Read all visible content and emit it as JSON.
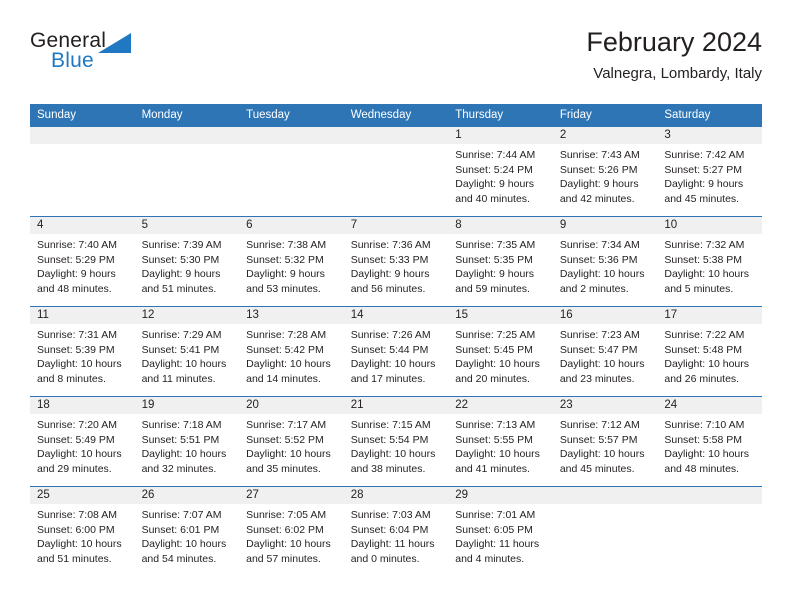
{
  "brand": {
    "name_top": "General",
    "name_bottom": "Blue",
    "accent_color": "#1f78c1"
  },
  "header": {
    "month_title": "February 2024",
    "location": "Valnegra, Lombardy, Italy"
  },
  "colors": {
    "header_blue": "#2e75b6",
    "daynum_band": "#f0f0f0",
    "text": "#231f20"
  },
  "weekday_headers": [
    "Sunday",
    "Monday",
    "Tuesday",
    "Wednesday",
    "Thursday",
    "Friday",
    "Saturday"
  ],
  "labels": {
    "sunrise_prefix": "Sunrise:",
    "sunset_prefix": "Sunset:",
    "daylight_prefix": "Daylight:"
  },
  "weeks": [
    [
      {
        "day": "",
        "sunrise": "",
        "sunset": "",
        "daylight_line1": "",
        "daylight_line2": ""
      },
      {
        "day": "",
        "sunrise": "",
        "sunset": "",
        "daylight_line1": "",
        "daylight_line2": ""
      },
      {
        "day": "",
        "sunrise": "",
        "sunset": "",
        "daylight_line1": "",
        "daylight_line2": ""
      },
      {
        "day": "",
        "sunrise": "",
        "sunset": "",
        "daylight_line1": "",
        "daylight_line2": ""
      },
      {
        "day": "1",
        "sunrise": "Sunrise: 7:44 AM",
        "sunset": "Sunset: 5:24 PM",
        "daylight_line1": "Daylight: 9 hours",
        "daylight_line2": "and 40 minutes."
      },
      {
        "day": "2",
        "sunrise": "Sunrise: 7:43 AM",
        "sunset": "Sunset: 5:26 PM",
        "daylight_line1": "Daylight: 9 hours",
        "daylight_line2": "and 42 minutes."
      },
      {
        "day": "3",
        "sunrise": "Sunrise: 7:42 AM",
        "sunset": "Sunset: 5:27 PM",
        "daylight_line1": "Daylight: 9 hours",
        "daylight_line2": "and 45 minutes."
      }
    ],
    [
      {
        "day": "4",
        "sunrise": "Sunrise: 7:40 AM",
        "sunset": "Sunset: 5:29 PM",
        "daylight_line1": "Daylight: 9 hours",
        "daylight_line2": "and 48 minutes."
      },
      {
        "day": "5",
        "sunrise": "Sunrise: 7:39 AM",
        "sunset": "Sunset: 5:30 PM",
        "daylight_line1": "Daylight: 9 hours",
        "daylight_line2": "and 51 minutes."
      },
      {
        "day": "6",
        "sunrise": "Sunrise: 7:38 AM",
        "sunset": "Sunset: 5:32 PM",
        "daylight_line1": "Daylight: 9 hours",
        "daylight_line2": "and 53 minutes."
      },
      {
        "day": "7",
        "sunrise": "Sunrise: 7:36 AM",
        "sunset": "Sunset: 5:33 PM",
        "daylight_line1": "Daylight: 9 hours",
        "daylight_line2": "and 56 minutes."
      },
      {
        "day": "8",
        "sunrise": "Sunrise: 7:35 AM",
        "sunset": "Sunset: 5:35 PM",
        "daylight_line1": "Daylight: 9 hours",
        "daylight_line2": "and 59 minutes."
      },
      {
        "day": "9",
        "sunrise": "Sunrise: 7:34 AM",
        "sunset": "Sunset: 5:36 PM",
        "daylight_line1": "Daylight: 10 hours",
        "daylight_line2": "and 2 minutes."
      },
      {
        "day": "10",
        "sunrise": "Sunrise: 7:32 AM",
        "sunset": "Sunset: 5:38 PM",
        "daylight_line1": "Daylight: 10 hours",
        "daylight_line2": "and 5 minutes."
      }
    ],
    [
      {
        "day": "11",
        "sunrise": "Sunrise: 7:31 AM",
        "sunset": "Sunset: 5:39 PM",
        "daylight_line1": "Daylight: 10 hours",
        "daylight_line2": "and 8 minutes."
      },
      {
        "day": "12",
        "sunrise": "Sunrise: 7:29 AM",
        "sunset": "Sunset: 5:41 PM",
        "daylight_line1": "Daylight: 10 hours",
        "daylight_line2": "and 11 minutes."
      },
      {
        "day": "13",
        "sunrise": "Sunrise: 7:28 AM",
        "sunset": "Sunset: 5:42 PM",
        "daylight_line1": "Daylight: 10 hours",
        "daylight_line2": "and 14 minutes."
      },
      {
        "day": "14",
        "sunrise": "Sunrise: 7:26 AM",
        "sunset": "Sunset: 5:44 PM",
        "daylight_line1": "Daylight: 10 hours",
        "daylight_line2": "and 17 minutes."
      },
      {
        "day": "15",
        "sunrise": "Sunrise: 7:25 AM",
        "sunset": "Sunset: 5:45 PM",
        "daylight_line1": "Daylight: 10 hours",
        "daylight_line2": "and 20 minutes."
      },
      {
        "day": "16",
        "sunrise": "Sunrise: 7:23 AM",
        "sunset": "Sunset: 5:47 PM",
        "daylight_line1": "Daylight: 10 hours",
        "daylight_line2": "and 23 minutes."
      },
      {
        "day": "17",
        "sunrise": "Sunrise: 7:22 AM",
        "sunset": "Sunset: 5:48 PM",
        "daylight_line1": "Daylight: 10 hours",
        "daylight_line2": "and 26 minutes."
      }
    ],
    [
      {
        "day": "18",
        "sunrise": "Sunrise: 7:20 AM",
        "sunset": "Sunset: 5:49 PM",
        "daylight_line1": "Daylight: 10 hours",
        "daylight_line2": "and 29 minutes."
      },
      {
        "day": "19",
        "sunrise": "Sunrise: 7:18 AM",
        "sunset": "Sunset: 5:51 PM",
        "daylight_line1": "Daylight: 10 hours",
        "daylight_line2": "and 32 minutes."
      },
      {
        "day": "20",
        "sunrise": "Sunrise: 7:17 AM",
        "sunset": "Sunset: 5:52 PM",
        "daylight_line1": "Daylight: 10 hours",
        "daylight_line2": "and 35 minutes."
      },
      {
        "day": "21",
        "sunrise": "Sunrise: 7:15 AM",
        "sunset": "Sunset: 5:54 PM",
        "daylight_line1": "Daylight: 10 hours",
        "daylight_line2": "and 38 minutes."
      },
      {
        "day": "22",
        "sunrise": "Sunrise: 7:13 AM",
        "sunset": "Sunset: 5:55 PM",
        "daylight_line1": "Daylight: 10 hours",
        "daylight_line2": "and 41 minutes."
      },
      {
        "day": "23",
        "sunrise": "Sunrise: 7:12 AM",
        "sunset": "Sunset: 5:57 PM",
        "daylight_line1": "Daylight: 10 hours",
        "daylight_line2": "and 45 minutes."
      },
      {
        "day": "24",
        "sunrise": "Sunrise: 7:10 AM",
        "sunset": "Sunset: 5:58 PM",
        "daylight_line1": "Daylight: 10 hours",
        "daylight_line2": "and 48 minutes."
      }
    ],
    [
      {
        "day": "25",
        "sunrise": "Sunrise: 7:08 AM",
        "sunset": "Sunset: 6:00 PM",
        "daylight_line1": "Daylight: 10 hours",
        "daylight_line2": "and 51 minutes."
      },
      {
        "day": "26",
        "sunrise": "Sunrise: 7:07 AM",
        "sunset": "Sunset: 6:01 PM",
        "daylight_line1": "Daylight: 10 hours",
        "daylight_line2": "and 54 minutes."
      },
      {
        "day": "27",
        "sunrise": "Sunrise: 7:05 AM",
        "sunset": "Sunset: 6:02 PM",
        "daylight_line1": "Daylight: 10 hours",
        "daylight_line2": "and 57 minutes."
      },
      {
        "day": "28",
        "sunrise": "Sunrise: 7:03 AM",
        "sunset": "Sunset: 6:04 PM",
        "daylight_line1": "Daylight: 11 hours",
        "daylight_line2": "and 0 minutes."
      },
      {
        "day": "29",
        "sunrise": "Sunrise: 7:01 AM",
        "sunset": "Sunset: 6:05 PM",
        "daylight_line1": "Daylight: 11 hours",
        "daylight_line2": "and 4 minutes."
      },
      {
        "day": "",
        "sunrise": "",
        "sunset": "",
        "daylight_line1": "",
        "daylight_line2": ""
      },
      {
        "day": "",
        "sunrise": "",
        "sunset": "",
        "daylight_line1": "",
        "daylight_line2": ""
      }
    ]
  ]
}
